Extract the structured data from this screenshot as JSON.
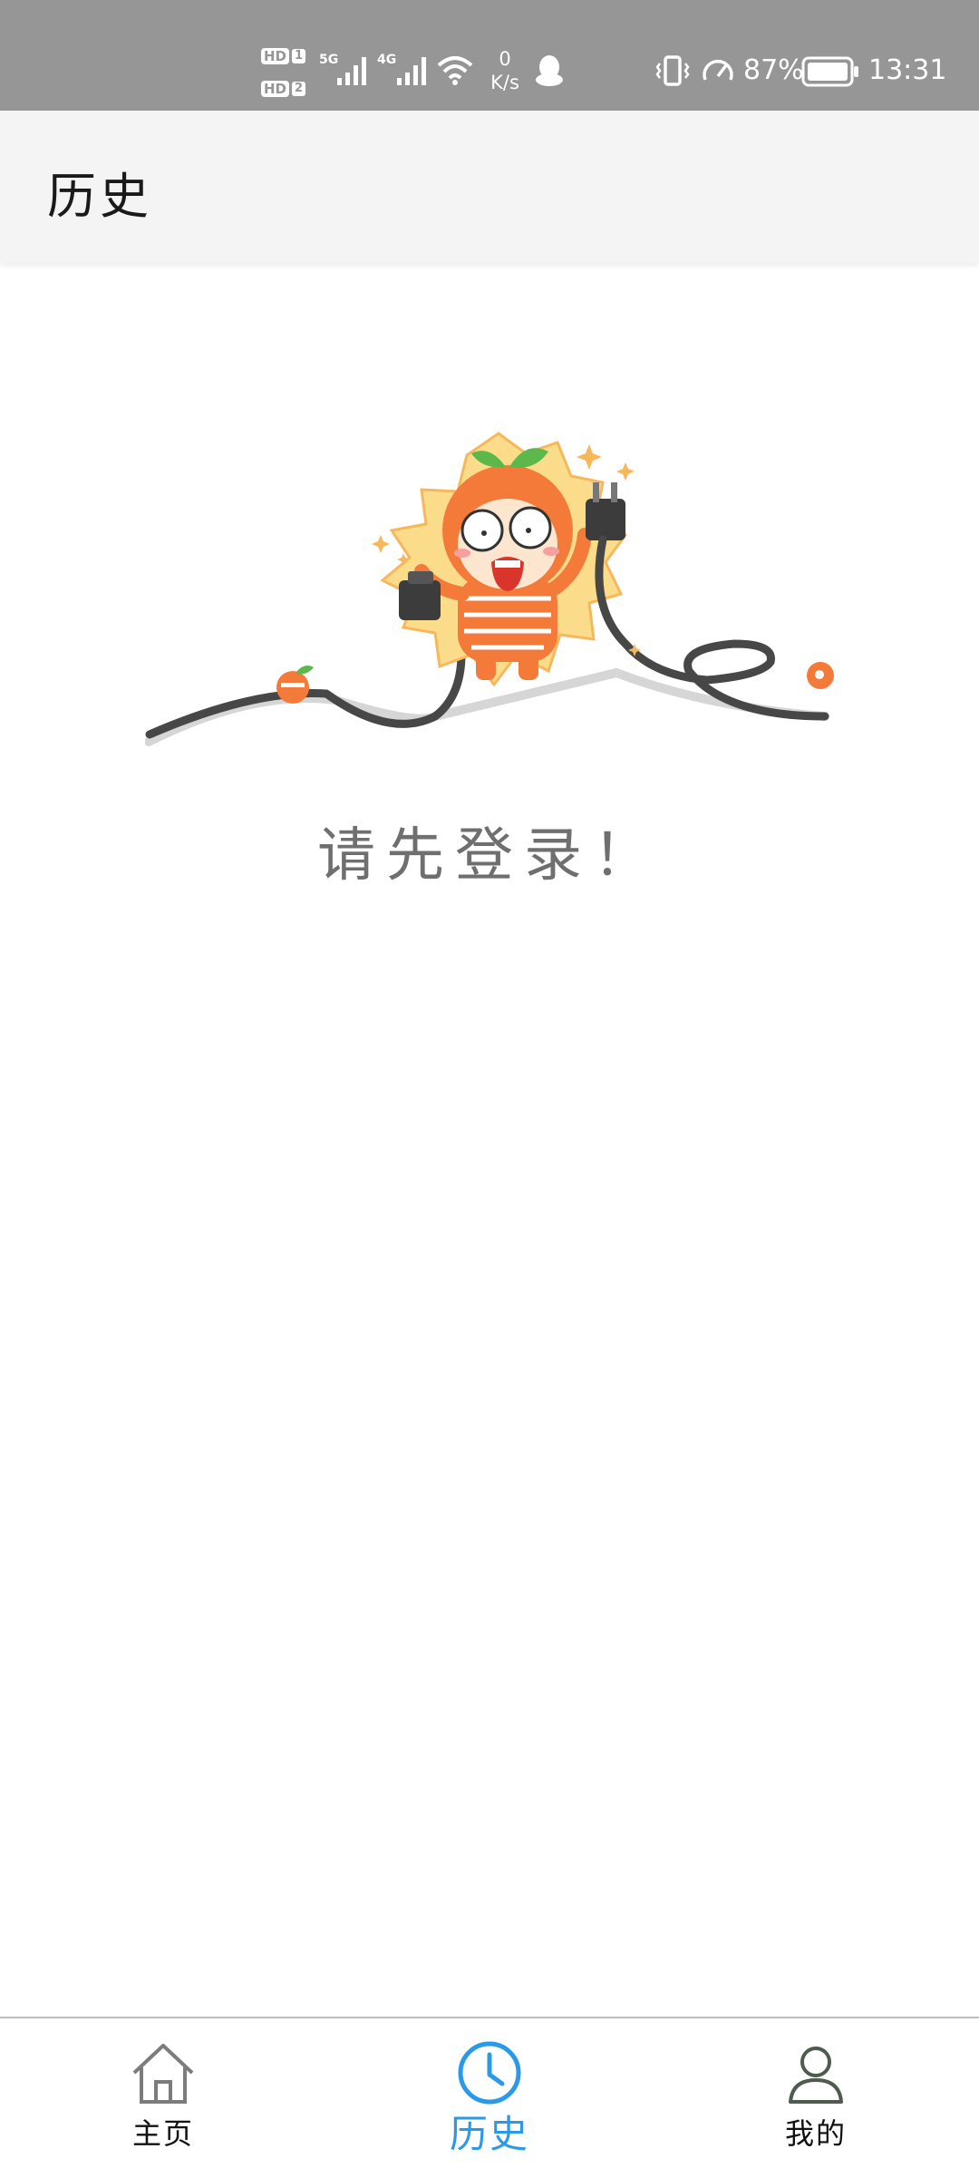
{
  "status_bar": {
    "hd1": "HD",
    "sim1": "1",
    "hd2": "HD",
    "sim2": "2",
    "net1": "5G",
    "net2": "4G",
    "speed_value": "0",
    "speed_unit": "K/s",
    "battery": "87%",
    "time": "13:31"
  },
  "header": {
    "title": "历史"
  },
  "main": {
    "message": "请先登录！"
  },
  "bottom_nav": {
    "items": [
      {
        "label": "主页",
        "icon": "home-icon",
        "active": false
      },
      {
        "label": "历史",
        "icon": "clock-icon",
        "active": true
      },
      {
        "label": "我的",
        "icon": "user-icon",
        "active": false
      }
    ]
  },
  "colors": {
    "accent": "#2a9ae8",
    "status_bar": "#969696",
    "header_bg": "#f4f4f4",
    "message_text": "#6f6f6f"
  }
}
